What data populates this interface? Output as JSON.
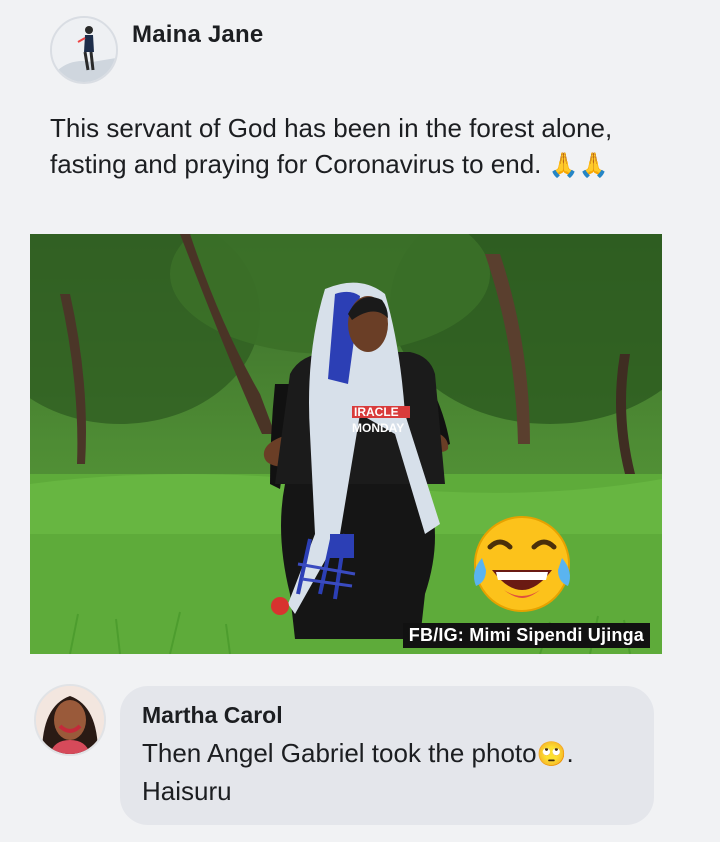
{
  "post": {
    "author": "Maina Jane",
    "text": "This servant of God has been in the forest alone, fasting and praying for Coronavirus to end.",
    "trailing_emoji": "🙏🙏",
    "image": {
      "watermark": "FB/IG: Mimi Sipendi Ujinga",
      "shirt_text_1": "IRACLE",
      "shirt_text_2": "MONDAY",
      "overlay_emoji": "tears-of-joy"
    }
  },
  "comment": {
    "author": "Martha Carol",
    "text": "Then Angel Gabriel took the photo",
    "emoji": "🙄",
    "text_end": ". Haisuru"
  },
  "colors": {
    "background": "#f1f2f4",
    "bubble": "#e4e6eb",
    "text": "#1c1e21"
  }
}
